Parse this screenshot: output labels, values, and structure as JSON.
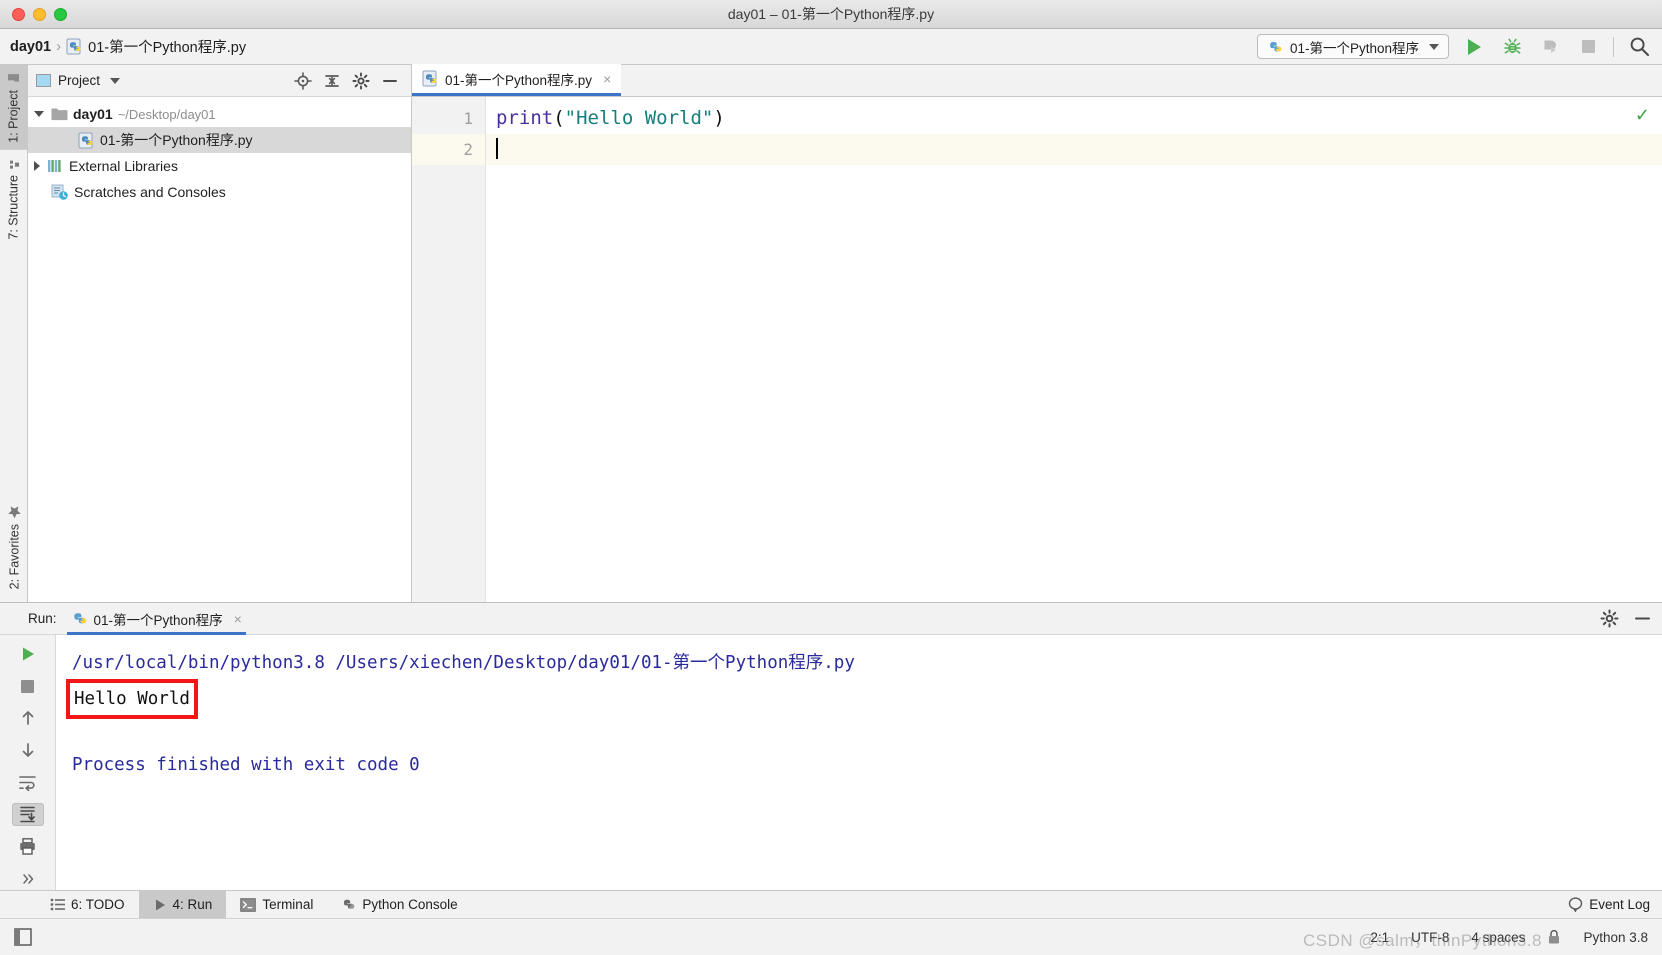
{
  "window": {
    "title": "day01 – 01-第一个Python程序.py",
    "controls": [
      "close",
      "minimize",
      "zoom"
    ]
  },
  "navbar": {
    "breadcrumb": {
      "project": "day01",
      "separator": "›",
      "file": "01-第一个Python程序.py"
    },
    "run_config": {
      "name": "01-第一个Python程序",
      "icon": "python-icon"
    },
    "actions": [
      {
        "name": "run-button",
        "icon": "play-icon",
        "label": "Run"
      },
      {
        "name": "debug-button",
        "icon": "bug-icon",
        "label": "Debug"
      },
      {
        "name": "coverage-button",
        "icon": "coverage-icon",
        "label": "Run with Coverage"
      },
      {
        "name": "stop-button",
        "icon": "stop-icon",
        "label": "Stop"
      },
      {
        "name": "search-button",
        "icon": "search-icon",
        "label": "Search Everywhere"
      }
    ]
  },
  "left_strip": {
    "tabs": [
      {
        "label": "1: Project",
        "icon": "project-icon",
        "active": true
      },
      {
        "label": "7: Structure",
        "icon": "structure-icon",
        "active": false
      }
    ],
    "bottom_tabs": [
      {
        "label": "2: Favorites",
        "icon": "star-icon",
        "active": false
      }
    ]
  },
  "project_panel": {
    "title": "Project",
    "toolbar": [
      {
        "name": "locate-icon",
        "label": "Select Opened File"
      },
      {
        "name": "collapse-all-icon",
        "label": "Collapse All"
      },
      {
        "name": "gear-icon",
        "label": "Settings"
      },
      {
        "name": "hide-icon",
        "label": "Hide"
      }
    ],
    "tree": [
      {
        "label": "day01",
        "path": "~/Desktop/day01",
        "icon": "folder-icon",
        "expanded": true,
        "level": 0,
        "bold": true,
        "selected": false
      },
      {
        "label": "01-第一个Python程序.py",
        "path": "",
        "icon": "python-file-icon",
        "expanded": null,
        "level": 1,
        "bold": false,
        "selected": true
      },
      {
        "label": "External Libraries",
        "path": "",
        "icon": "libraries-icon",
        "expanded": false,
        "level": 0,
        "bold": false,
        "selected": false
      },
      {
        "label": "Scratches and Consoles",
        "path": "",
        "icon": "scratches-icon",
        "expanded": null,
        "level": 0,
        "bold": false,
        "selected": false
      }
    ]
  },
  "editor": {
    "tab": {
      "label": "01-第一个Python程序.py",
      "icon": "python-file-icon",
      "close": "×"
    },
    "inspection_status": "✓",
    "lines": [
      {
        "number": "1",
        "tokens": [
          {
            "text": "print",
            "type": "function"
          },
          {
            "text": "(",
            "type": "punct"
          },
          {
            "text": "\"Hello World\"",
            "type": "string"
          },
          {
            "text": ")",
            "type": "punct"
          }
        ],
        "current": false
      },
      {
        "number": "2",
        "tokens": [],
        "current": true
      }
    ]
  },
  "run_window": {
    "label": "Run:",
    "tab": {
      "label": "01-第一个Python程序",
      "icon": "python-icon",
      "close": "×"
    },
    "header_actions": [
      {
        "name": "gear-icon",
        "label": "Settings"
      },
      {
        "name": "hide-icon",
        "label": "Hide"
      }
    ],
    "sidebar_actions": [
      {
        "name": "rerun-button",
        "icon": "play-icon"
      },
      {
        "name": "stop-button",
        "icon": "stop-icon"
      },
      {
        "name": "up-stacktrace-button",
        "icon": "arrow-up-icon"
      },
      {
        "name": "down-stacktrace-button",
        "icon": "arrow-down-icon"
      },
      {
        "name": "soft-wrap-button",
        "icon": "wrap-icon"
      },
      {
        "name": "print-button",
        "icon": "printer-icon"
      },
      {
        "name": "scroll-to-end-button",
        "icon": "scroll-end-icon"
      },
      {
        "name": "more-button",
        "icon": "chevrons-right-icon"
      }
    ],
    "console": {
      "command": "/usr/local/bin/python3.8 /Users/xiechen/Desktop/day01/01-第一个Python程序.py",
      "output": "Hello World",
      "output_highlighted": true,
      "highlight_color": "#f21717",
      "finish": "Process finished with exit code 0"
    }
  },
  "bottom_bar": {
    "buttons": [
      {
        "label": "6: TODO",
        "key": "6",
        "text": ": TODO",
        "icon": "todo-icon",
        "active": false
      },
      {
        "label": "4: Run",
        "key": "4",
        "text": ": Run",
        "icon": "play-icon",
        "active": true
      },
      {
        "label": "Terminal",
        "key": "",
        "text": "Terminal",
        "icon": "terminal-icon",
        "active": false
      },
      {
        "label": "Python Console",
        "key": "",
        "text": "Python Console",
        "icon": "python-icon",
        "active": false
      }
    ],
    "event_log": {
      "label": "Event Log",
      "icon": "balloon-icon"
    }
  },
  "status_bar": {
    "left_icon": "layout-icon",
    "caret_position": "2:1",
    "encoding": "UTF-8",
    "indent": "4 spaces",
    "lock_icon": "lock-icon",
    "interpreter": "Python 3.8",
    "watermark": "CSDN @salm，thinPython3.8"
  },
  "colors": {
    "accent": "#3c74c8",
    "run_green": "#4caf50",
    "string": "#167e7e",
    "keyword": "#4b2fa0",
    "console_blue": "#2a2a9c",
    "highlight_red": "#f21717"
  }
}
